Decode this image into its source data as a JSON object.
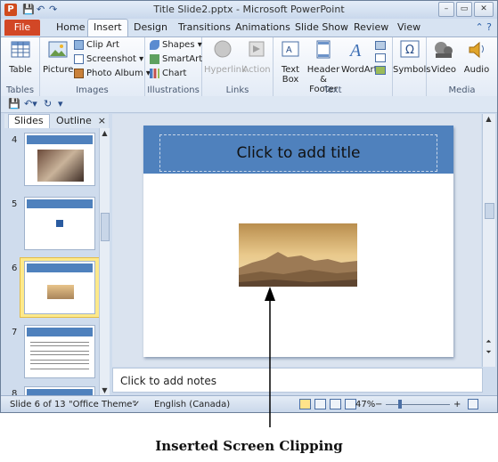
{
  "window": {
    "title": "Title Slide2.pptx - Microsoft PowerPoint",
    "app_icon": "P",
    "buttons": {
      "minimize": "–",
      "restore": "▭",
      "close": "✕"
    }
  },
  "tabs": {
    "file": "File",
    "items": [
      "Home",
      "Insert",
      "Design",
      "Transitions",
      "Animations",
      "Slide Show",
      "Review",
      "View"
    ],
    "active": "Insert",
    "help_icons": "⌃ ?"
  },
  "ribbon": {
    "groups": {
      "tables": {
        "label": "Tables",
        "table": "Table"
      },
      "images": {
        "label": "Images",
        "picture": "Picture",
        "clip_art": "Clip Art",
        "screenshot": "Screenshot ▾",
        "photo_album": "Photo Album ▾"
      },
      "illustrations": {
        "label": "Illustrations",
        "shapes": "Shapes ▾",
        "smartart": "SmartArt",
        "chart": "Chart"
      },
      "links": {
        "label": "Links",
        "hyperlink": "Hyperlink",
        "action": "Action"
      },
      "text": {
        "label": "Text",
        "text_box": [
          "Text",
          "Box"
        ],
        "header_footer": [
          "Header",
          "& Footer"
        ],
        "wordart": "WordArt"
      },
      "symbols": {
        "label": "",
        "symbols": "Symbols"
      },
      "media": {
        "label": "Media",
        "video": "Video",
        "audio": "Audio"
      }
    }
  },
  "left_pane": {
    "tabs": [
      "Slides",
      "Outline"
    ],
    "close": "×",
    "thumbnails": [
      {
        "number": "4"
      },
      {
        "number": "5"
      },
      {
        "number": "6",
        "selected": true
      },
      {
        "number": "7"
      },
      {
        "number": "8"
      }
    ]
  },
  "slide": {
    "title_placeholder": "Click to add title"
  },
  "notes": {
    "placeholder": "Click to add notes"
  },
  "status_bar": {
    "slide_info": "Slide 6 of 13",
    "theme": "\"Office Theme\"",
    "language": "English (Canada)",
    "zoom": "47%",
    "zoom_minus": "−",
    "zoom_plus": "+"
  },
  "caption": "Inserted Screen Clipping",
  "colors": {
    "title_bar_fill": "#4f81bd",
    "file_tab": "#d24726",
    "selected_thumb": "#fde98a"
  }
}
